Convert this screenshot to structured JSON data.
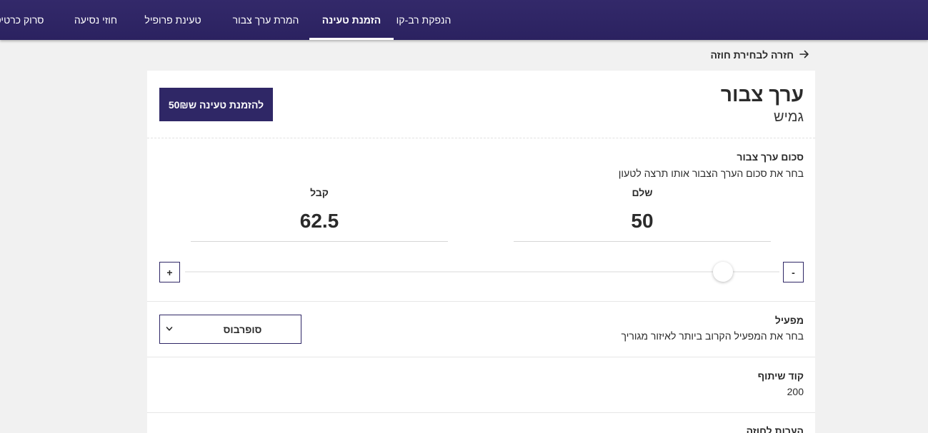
{
  "nav": {
    "tabs": [
      {
        "label": "הנפקת רב-קו"
      },
      {
        "label": "הזמנת טעינה",
        "active": true
      },
      {
        "label": "המרת ערך צבור"
      },
      {
        "label": "טעינת פרופיל"
      },
      {
        "label": "חוזי נסיעה"
      },
      {
        "label": "סרוק כרטיס"
      }
    ]
  },
  "back": {
    "label": "חזרה לבחירת חוזה",
    "icon": "arrow-right-icon"
  },
  "product": {
    "title": "ערך צבור",
    "subtitle": "גמיש",
    "order_button": "להזמנת טעינה ש50₪"
  },
  "amount": {
    "title": "סכום ערך צבור",
    "description": "בחר את סכום הערך הצבור אותו תרצה לטעון",
    "pay_label": "שלם",
    "pay_value": "50",
    "receive_label": "קבל",
    "receive_value": "62.5",
    "minus_label": "-",
    "plus_label": "+",
    "slider_fraction": 0.095
  },
  "operator": {
    "title": "מפעיל",
    "description": "בחר את המפעיל הקרוב ביותר לאיזור מגוריך",
    "selected": "סופרבוס",
    "icon": "chevron-down-icon"
  },
  "share_code": {
    "title": "קוד שיתוף",
    "value": "200"
  },
  "notes": {
    "title": "הערות לחוזה"
  },
  "colors": {
    "nav_bg": "#2f2766",
    "accent": "#2f2766",
    "page_bg": "#f1f1f1"
  }
}
